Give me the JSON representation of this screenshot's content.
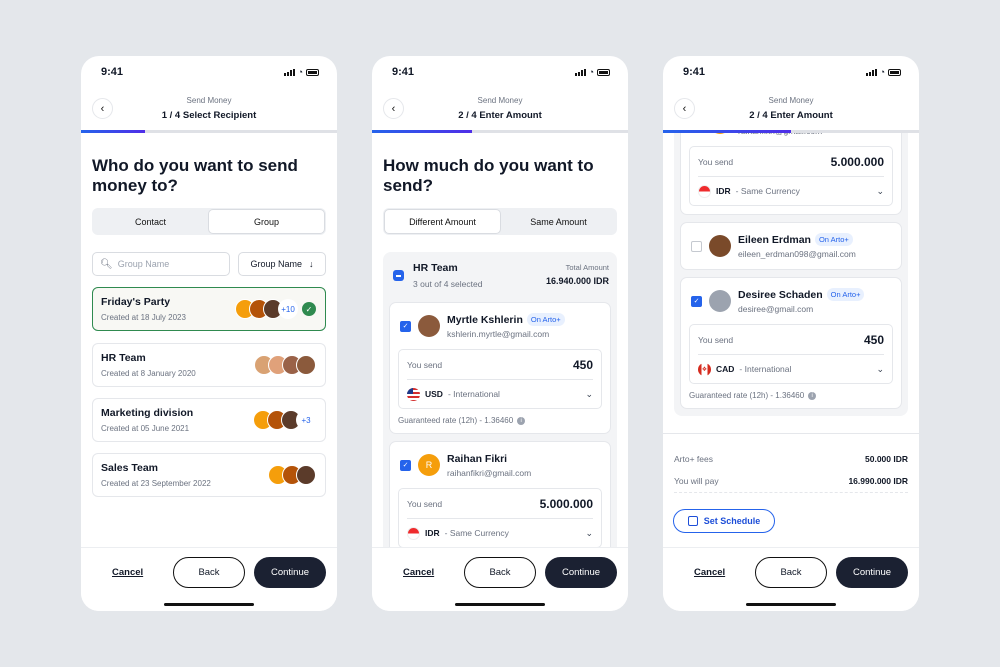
{
  "status_time": "9:41",
  "header_sub": "Send Money",
  "colors": {
    "accent": "#2563eb",
    "selected_border": "#2f8a4f",
    "primary_button": "#1b2132",
    "background": "#e4e7eb"
  },
  "screens": [
    {
      "title": "1 / 4 Select Recipient",
      "progress": 0.25,
      "heading": "Who do you want to send money to?",
      "tabs": [
        "Contact",
        "Group"
      ],
      "active_tab": "Group",
      "search_placeholder": "Group Name",
      "sort_label": "Group Name",
      "groups": [
        {
          "name": "Friday's Party",
          "created": "Created at 18 July 2023",
          "extra": "+10",
          "selected": true
        },
        {
          "name": "HR Team",
          "created": "Created at 8 January 2020",
          "extra": "",
          "selected": false
        },
        {
          "name": "Marketing division",
          "created": "Created at 05 June  2021",
          "extra": "+3",
          "selected": false
        },
        {
          "name": "Sales Team",
          "created": "Created at 23 September 2022",
          "extra": "",
          "selected": false
        }
      ]
    },
    {
      "title": "2 / 4 Enter Amount",
      "progress": 0.39,
      "heading": "How much do you want to send?",
      "tabs": [
        "Different Amount",
        "Same Amount"
      ],
      "active_tab": "Different Amount",
      "group": {
        "name": "HR Team",
        "selected": "3 out of 4 selected",
        "total_label": "Total Amount",
        "total": "16.940.000 IDR"
      }
    },
    {
      "title": "2 / 4 Enter Amount",
      "progress": 0.5
    }
  ],
  "members": [
    {
      "name": "Myrtle Kshlerin",
      "badge": "On Arto+",
      "email": "kshlerin.myrtle@gmail.com",
      "checked": true,
      "send_label": "You send",
      "amount": "450",
      "currency": "USD",
      "currency_type": "- International",
      "rate": "Guaranteed rate (12h) - 1.36460"
    },
    {
      "name": "Raihan Fikri",
      "initial": "R",
      "email": "raihanfikri@gmail.com",
      "checked": true,
      "send_label": "You send",
      "amount": "5.000.000",
      "currency": "IDR",
      "currency_type": "- Same Currency"
    },
    {
      "name": "Eileen Erdman",
      "badge": "On Arto+",
      "email": "eileen_erdman098@gmail.com",
      "checked": false
    },
    {
      "name": "Desiree Schaden",
      "badge": "On Arto+",
      "email": "desiree@gmail.com",
      "checked": true,
      "send_label": "You send",
      "amount": "450",
      "currency": "CAD",
      "currency_type": "- International",
      "rate": "Guaranteed rate (12h) - 1.36460"
    }
  ],
  "summary": {
    "fees_label": "Arto+ fees",
    "fees": "50.000 IDR",
    "pay_label": "You will pay",
    "pay": "16.990.000 IDR",
    "schedule": "Set Schedule"
  },
  "footer": {
    "cancel": "Cancel",
    "back": "Back",
    "continue": "Continue"
  }
}
